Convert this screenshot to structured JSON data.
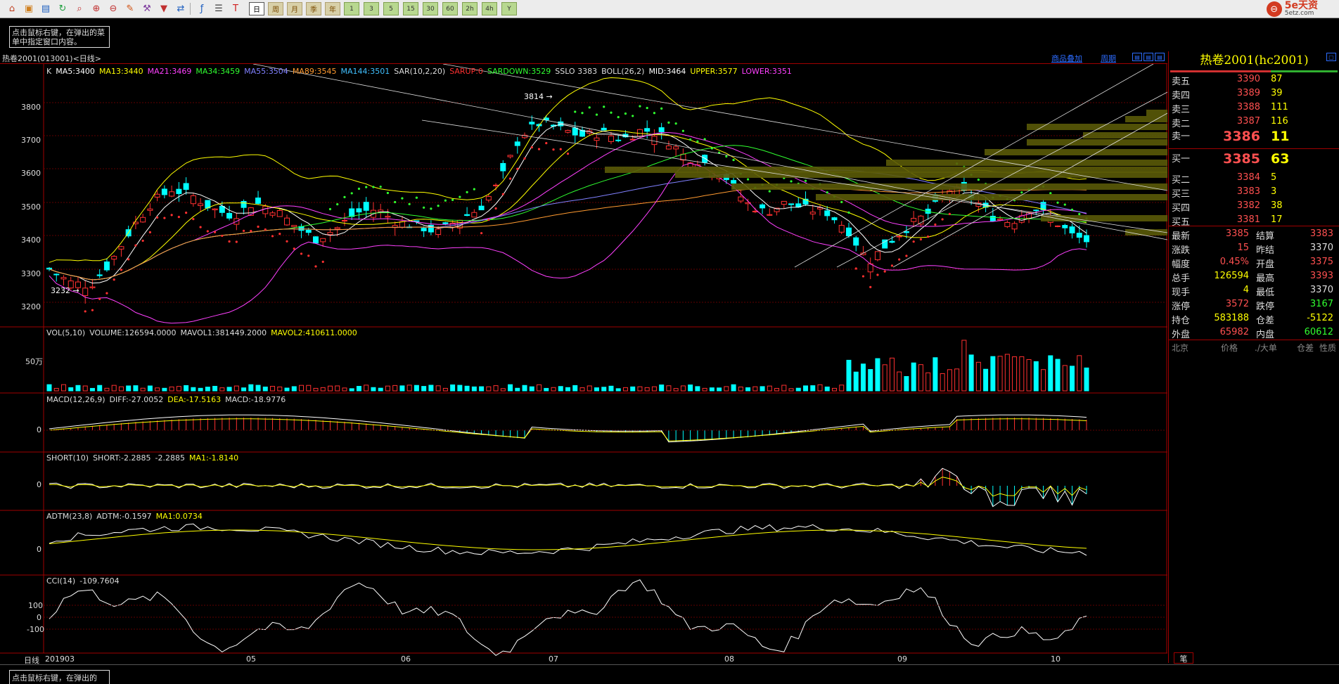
{
  "toolbar": {
    "icons": [
      "home-icon",
      "folder-icon",
      "stock-icon",
      "refresh-icon",
      "zoom-icon",
      "zoom-in-icon",
      "zoom-out-icon",
      "draw-icon",
      "tools-icon",
      "filter-icon",
      "compare-icon",
      "indicator-icon",
      "list-icon",
      "tick-icon"
    ],
    "periods": [
      "日",
      "周",
      "月",
      "季",
      "年"
    ],
    "minutes": [
      "1",
      "3",
      "5",
      "15",
      "30",
      "60",
      "2h",
      "4h",
      "Y"
    ]
  },
  "brand": {
    "logo": "5e天资",
    "sub": "5etz.com"
  },
  "hint": {
    "text": "点击鼠标右键，在弹出的菜单中指定窗口内容。",
    "text_bottom": "点击鼠标右键，在弹出的"
  },
  "chart": {
    "contract": "热卷2001(013001)<日线>",
    "link_overlay": "商品叠加",
    "link_period": "周期",
    "main_indicators": [
      {
        "text": "K",
        "color": "#dddddd"
      },
      {
        "text": "MA5:3400",
        "color": "#ffffff"
      },
      {
        "text": "MA13:3440",
        "color": "#ffff00"
      },
      {
        "text": "MA21:3469",
        "color": "#ff40ff"
      },
      {
        "text": "MA34:3459",
        "color": "#30ff30"
      },
      {
        "text": "MA55:3504",
        "color": "#8080ff"
      },
      {
        "text": "MA89:3545",
        "color": "#ff9a30"
      },
      {
        "text": "MA144:3501",
        "color": "#40c0ff"
      },
      {
        "text": "SAR(10,2,20)",
        "color": "#dddddd"
      },
      {
        "text": "SARUP:0",
        "color": "#ff3030"
      },
      {
        "text": "SARDOWN:3529",
        "color": "#30ff30"
      },
      {
        "text": "SSLO 3383",
        "color": "#dddddd"
      },
      {
        "text": "BOLL(26,2)",
        "color": "#dddddd"
      },
      {
        "text": "MID:3464",
        "color": "#ffffff"
      },
      {
        "text": "UPPER:3577",
        "color": "#ffff00"
      },
      {
        "text": "LOWER:3351",
        "color": "#ff40ff"
      }
    ],
    "y_ticks": [
      "3800",
      "3700",
      "3600",
      "3500",
      "3400",
      "3300",
      "3200"
    ],
    "high_label": "3814",
    "low_label": "3232",
    "vol": {
      "name": "VOL(5,10)",
      "volume": "VOLUME:126594.0000",
      "mavol1": "MAVOL1:381449.2000",
      "mavol2": "MAVOL2:410611.0000",
      "tick": "50万"
    },
    "macd": {
      "name": "MACD(12,26,9)",
      "diff": "DIFF:-27.0052",
      "dea": "DEA:-17.5163",
      "macd": "MACD:-18.9776",
      "tick": "0"
    },
    "short": {
      "name": "SHORT(10)",
      "v1": "SHORT:-2.2885",
      "v2": "-2.2885",
      "ma": "MA1:-1.8140",
      "tick": "0"
    },
    "adtm": {
      "name": "ADTM(23,8)",
      "v1": "ADTM:-0.1597",
      "ma": "MA1:0.0734",
      "tick": "0"
    },
    "cci": {
      "name": "CCI(14)",
      "v1": "-109.7604",
      "ticks": [
        "100",
        "0",
        "-100"
      ]
    },
    "x_labels": [
      "日线",
      "201903",
      "05",
      "06",
      "07",
      "08",
      "09",
      "10"
    ]
  },
  "quote": {
    "title": "热卷2001(hc2001)",
    "asks": [
      {
        "label": "卖五",
        "price": "3390",
        "vol": "87"
      },
      {
        "label": "卖四",
        "price": "3389",
        "vol": "39"
      },
      {
        "label": "卖三",
        "price": "3388",
        "vol": "111"
      },
      {
        "label": "卖二",
        "price": "3387",
        "vol": "116"
      },
      {
        "label": "卖一",
        "price": "3386",
        "vol": "11"
      }
    ],
    "bids": [
      {
        "label": "买一",
        "price": "3385",
        "vol": "63"
      },
      {
        "label": "买二",
        "price": "3384",
        "vol": "5"
      },
      {
        "label": "买三",
        "price": "3383",
        "vol": "3"
      },
      {
        "label": "买四",
        "price": "3382",
        "vol": "38"
      },
      {
        "label": "买五",
        "price": "3381",
        "vol": "17"
      }
    ],
    "stats": [
      {
        "l1": "最新",
        "v1": "3385",
        "c1": "red",
        "l2": "结算",
        "v2": "3383",
        "c2": "red"
      },
      {
        "l1": "涨跌",
        "v1": "15",
        "c1": "red",
        "l2": "昨结",
        "v2": "3370",
        "c2": "white"
      },
      {
        "l1": "幅度",
        "v1": "0.45%",
        "c1": "red",
        "l2": "开盘",
        "v2": "3375",
        "c2": "red"
      },
      {
        "l1": "总手",
        "v1": "126594",
        "c1": "yellow",
        "l2": "最高",
        "v2": "3393",
        "c2": "red"
      },
      {
        "l1": "现手",
        "v1": "4",
        "c1": "yellow",
        "l2": "最低",
        "v2": "3370",
        "c2": "white"
      },
      {
        "l1": "涨停",
        "v1": "3572",
        "c1": "red",
        "l2": "跌停",
        "v2": "3167",
        "c2": "green"
      },
      {
        "l1": "持仓",
        "v1": "583188",
        "c1": "yellow",
        "l2": "仓差",
        "v2": "-5122",
        "c2": "yellow"
      },
      {
        "l1": "外盘",
        "v1": "65982",
        "c1": "red",
        "l2": "内盘",
        "v2": "60612",
        "c2": "green"
      }
    ],
    "tick_head": [
      "北京",
      "价格",
      "./大单",
      "仓差",
      "性质"
    ],
    "pen_tab": "笔"
  }
}
